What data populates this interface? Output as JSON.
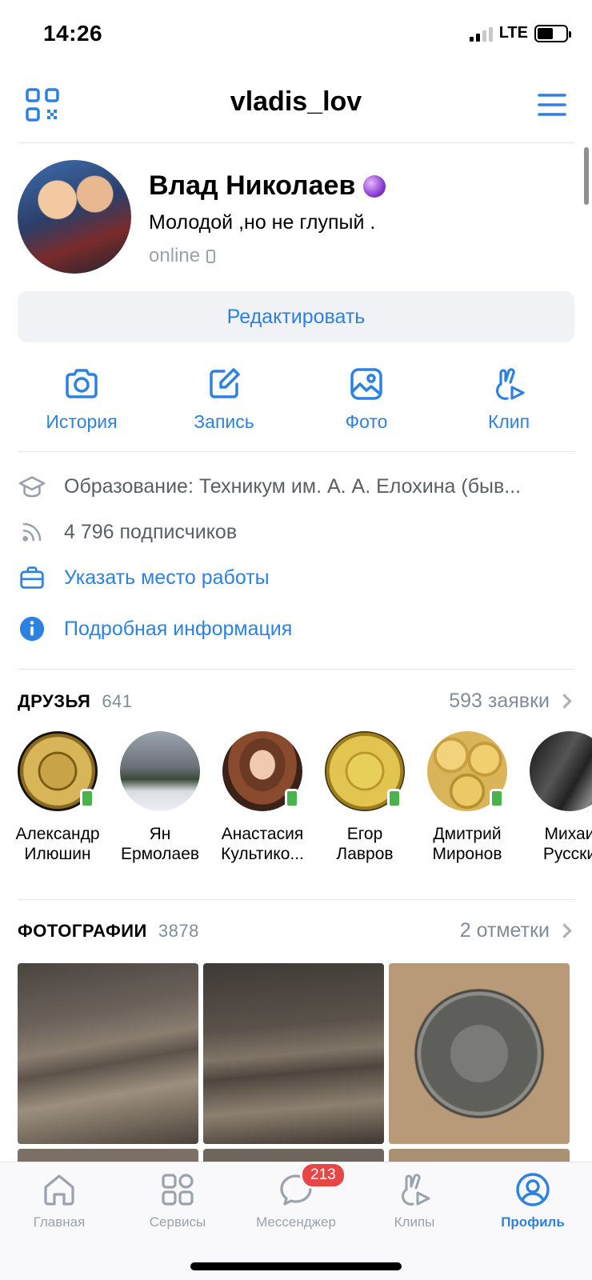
{
  "status_bar": {
    "time": "14:26",
    "network": "LTE",
    "signal_bars_active": 2,
    "battery_level": 0.55
  },
  "header": {
    "title": "vladis_lov",
    "qr_icon": "qr-code-icon",
    "menu_icon": "hamburger-menu-icon"
  },
  "profile": {
    "name": "Влад Николаев",
    "status": "Молодой ,но не глупый .",
    "online": "online",
    "edit_label": "Редактировать"
  },
  "actions": [
    {
      "label": "История",
      "icon": "camera-icon"
    },
    {
      "label": "Запись",
      "icon": "compose-icon"
    },
    {
      "label": "Фото",
      "icon": "image-icon"
    },
    {
      "label": "Клип",
      "icon": "clip-icon"
    }
  ],
  "info": {
    "education": "Образование: Техникум им. А. А. Елохина (быв...",
    "followers": "4 796 подписчиков",
    "work": "Указать место работы",
    "details": "Подробная информация"
  },
  "friends": {
    "title": "ДРУЗЬЯ",
    "count": "641",
    "requests": "593 заявки",
    "items": [
      {
        "first": "Александр",
        "last": "Илюшин",
        "online": true
      },
      {
        "first": "Ян",
        "last": "Ермолаев",
        "online": false
      },
      {
        "first": "Анастасия",
        "last": "Культико...",
        "online": true
      },
      {
        "first": "Егор",
        "last": "Лавров",
        "online": true
      },
      {
        "first": "Дмитрий",
        "last": "Миронов",
        "online": true
      },
      {
        "first": "Михаи",
        "last": "Русски",
        "online": false
      }
    ]
  },
  "photos": {
    "title": "ФОТОГРАФИИ",
    "count": "3878",
    "tags": "2 отметки"
  },
  "tabbar": {
    "items": [
      {
        "label": "Главная",
        "icon": "home-icon"
      },
      {
        "label": "Сервисы",
        "icon": "services-icon"
      },
      {
        "label": "Мессенджер",
        "icon": "chat-bubble-icon",
        "badge": "213"
      },
      {
        "label": "Клипы",
        "icon": "clips-icon"
      },
      {
        "label": "Профиль",
        "icon": "profile-icon",
        "active": true
      }
    ]
  },
  "colors": {
    "accent": "#2d81e0",
    "secondary": "#818c99",
    "online": "#4bb34b",
    "badge": "#e64646"
  }
}
